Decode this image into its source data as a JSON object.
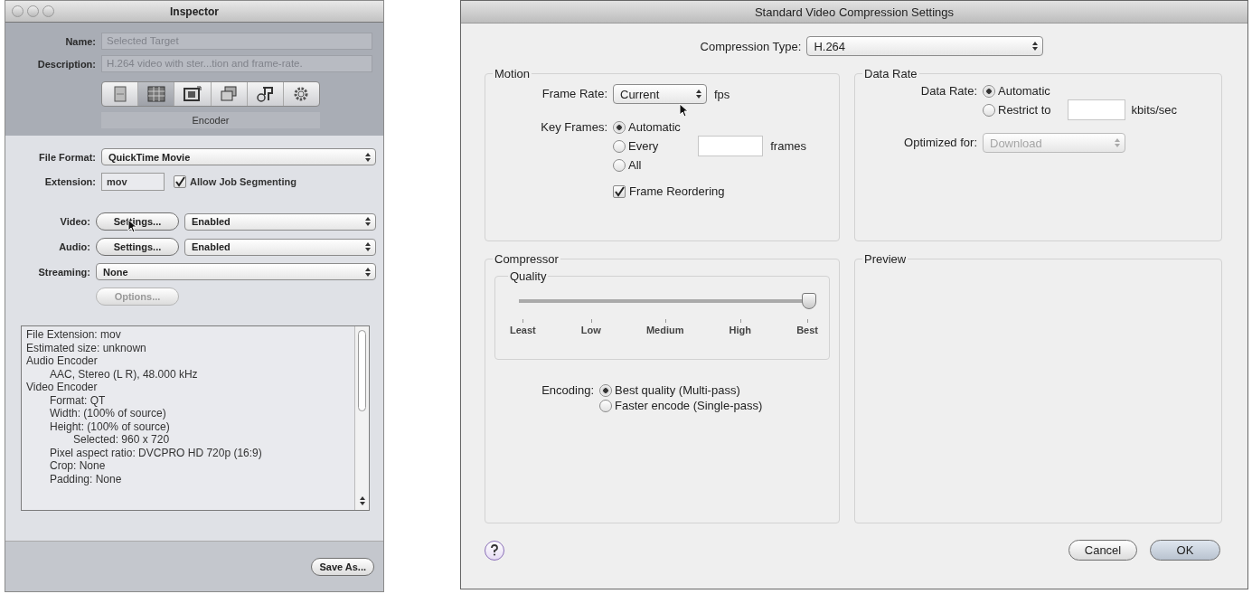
{
  "inspector": {
    "title": "Inspector",
    "name": {
      "label": "Name:",
      "value": "Selected Target"
    },
    "description": {
      "label": "Description:",
      "value": "H.264 video with ster...tion and frame-rate."
    },
    "tabs": [
      {
        "selected": false
      },
      {
        "selected": true
      },
      {
        "selected": false
      },
      {
        "selected": false
      },
      {
        "selected": false
      },
      {
        "selected": false
      }
    ],
    "tab_caption": "Encoder",
    "file_format": {
      "label": "File Format:",
      "value": "QuickTime Movie"
    },
    "extension": {
      "label": "Extension:",
      "value": "mov"
    },
    "allow_job_segmenting": {
      "label": "Allow Job Segmenting",
      "checked": true
    },
    "streams": [
      {
        "label": "Video:",
        "button": "Settings...",
        "value": "Enabled"
      },
      {
        "label": "Audio:",
        "button": "Settings...",
        "value": "Enabled"
      }
    ],
    "streaming": {
      "label": "Streaming:",
      "value": "None"
    },
    "options_button": {
      "label": "Options...",
      "disabled": true
    },
    "summary": [
      {
        "text": "File Extension: mov"
      },
      {
        "text": "Estimated size: unknown"
      },
      {
        "text": "Audio Encoder",
        "children": [
          {
            "text": "AAC, Stereo (L R), 48.000 kHz"
          }
        ]
      },
      {
        "text": "Video Encoder",
        "children": [
          {
            "text": "Format: QT"
          },
          {
            "text": "Width: (100% of source)"
          },
          {
            "text": "Height: (100% of source)",
            "children": [
              {
                "text": "Selected: 960 x 720"
              }
            ]
          },
          {
            "text": "Pixel aspect ratio: DVCPRO HD 720p (16:9)"
          },
          {
            "text": "Crop: None"
          },
          {
            "text": "Padding: None"
          }
        ]
      }
    ],
    "save_button": "Save As..."
  },
  "dialog": {
    "title": "Standard Video Compression Settings",
    "compression_type": {
      "label": "Compression Type:",
      "value": "H.264"
    },
    "motion": {
      "title": "Motion",
      "frame_rate": {
        "label": "Frame Rate:",
        "value": "Current",
        "unit": "fps"
      },
      "key_frames": {
        "label": "Key Frames:",
        "options": [
          {
            "label": "Automatic",
            "selected": true
          },
          {
            "label": "Every",
            "selected": false
          },
          {
            "label": "All",
            "selected": false
          }
        ],
        "unit": "frames"
      },
      "frame_reordering": {
        "label": "Frame Reordering",
        "checked": true
      }
    },
    "data_rate": {
      "title": "Data Rate",
      "label": "Data Rate:",
      "options": [
        {
          "label": "Automatic",
          "selected": true
        },
        {
          "label": "Restrict to",
          "selected": false
        }
      ],
      "unit": "kbits/sec",
      "optimized_for": {
        "label": "Optimized for:",
        "value": "Download",
        "disabled": true
      }
    },
    "compressor": {
      "title": "Compressor",
      "quality": {
        "title": "Quality",
        "level": 1,
        "ticks": [
          "Least",
          "Low",
          "Medium",
          "High",
          "Best"
        ]
      },
      "encoding": {
        "label": "Encoding:",
        "options": [
          {
            "label": "Best quality (Multi-pass)",
            "selected": true
          },
          {
            "label": "Faster encode (Single-pass)",
            "selected": false
          }
        ]
      }
    },
    "preview": {
      "title": "Preview"
    },
    "cancel_button": "Cancel",
    "ok_button": "OK"
  }
}
